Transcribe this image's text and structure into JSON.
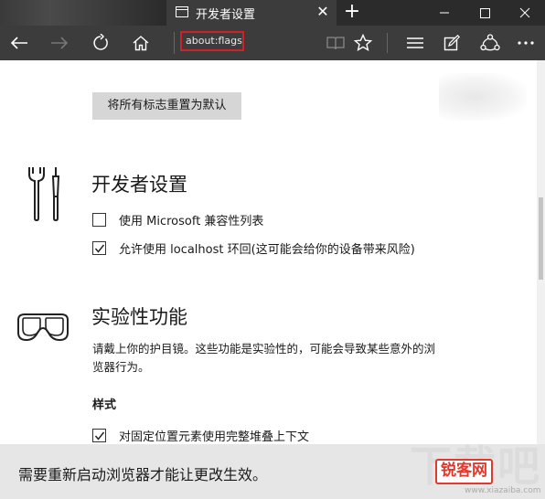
{
  "browser": {
    "tab": {
      "title": "开发者设置",
      "icon": "page-icon"
    },
    "address": "about:flags",
    "nav_icons": [
      "back-arrow-icon",
      "forward-arrow-icon",
      "refresh-icon",
      "home-icon"
    ],
    "tool_icons": [
      "reading-view-icon",
      "favorite-star-icon",
      "hub-icon",
      "web-note-icon",
      "share-icon",
      "more-icon"
    ]
  },
  "page": {
    "reset_button": "将所有标志重置为默认",
    "developer": {
      "title": "开发者设置",
      "icon": "tools-icon",
      "options": [
        {
          "label": "使用 Microsoft 兼容性列表",
          "checked": false
        },
        {
          "label": "允许使用 localhost 环回(这可能会给你的设备带来风险)",
          "checked": true
        }
      ]
    },
    "experimental": {
      "title": "实验性功能",
      "icon": "goggles-icon",
      "description": "请戴上你的护目镜。这些功能是实验性的，可能会导致某些意外的浏览器行为。",
      "subsection": "样式",
      "options": [
        {
          "label": "对固定位置元素使用完整堆叠上下文",
          "checked": true
        }
      ]
    },
    "restart_notice": "需要重新启动浏览器才能让更改生效。"
  },
  "watermark": {
    "big": "下载吧",
    "logo": "锐客网",
    "url": "www.xiazaiba.com"
  },
  "colors": {
    "chrome_dark": "#2b2b2b",
    "chrome_bar": "#3c3c3c",
    "highlight_red": "#d0202a",
    "button_gray": "#d6d6d6",
    "notice_bg": "#e6e6e6"
  }
}
